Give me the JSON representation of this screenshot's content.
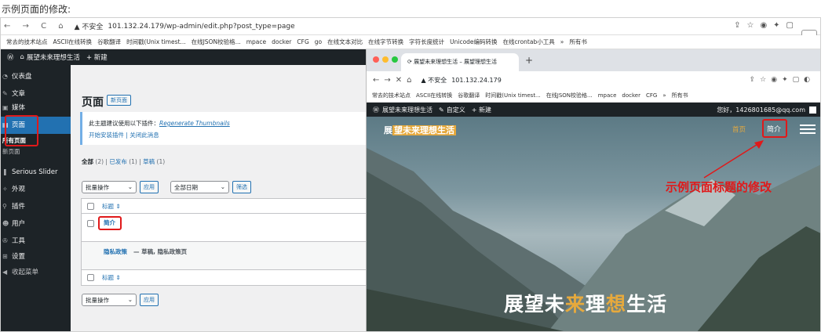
{
  "caption": "示例页面的修改:",
  "back_browser": {
    "nav_icons": "← → C ⌂",
    "warning": "▲ 不安全",
    "url": "101.132.24.179/wp-admin/edit.php?post_type=page",
    "bookmarks": [
      "常去的技术站点",
      "ASCII在线转换",
      "谷歌翻译",
      "时间戳(Unix timest...",
      "在线JSON校验格...",
      "mpace",
      "docker",
      "CFG",
      "go",
      "在线文本对比",
      "在线字节转换",
      "字符长度统计",
      "Unicode编码转换",
      "在线crontab小工具",
      "»",
      "所有书"
    ],
    "admin_bar": {
      "site": "展望未来理想生活",
      "new": "+ 新建"
    }
  },
  "sidebar": {
    "items": [
      "仪表盘",
      "文章",
      "媒体",
      "页面",
      "所有页面",
      "新页面",
      "Serious Slider",
      "外观",
      "插件",
      "用户",
      "工具",
      "设置",
      "收起菜单"
    ]
  },
  "wp_main": {
    "title": "页面",
    "add_new": "新页面",
    "notice_text": "此主题建议使用以下插件：",
    "notice_plugin": "Regenerate Thumbnails",
    "notice_links": "开始安装插件 | 关闭此消息",
    "filter_all": "全部",
    "filter_all_count": "(2)",
    "filter_published": "已发布",
    "filter_published_count": "(1)",
    "filter_draft": "草稿",
    "filter_draft_count": "(1)",
    "bulk_action": "批量操作",
    "apply": "应用",
    "all_dates": "全部日期",
    "filter_btn": "筛选",
    "col_title": "标题 ⇕",
    "row1_title": "简介",
    "row2_title": "隐私政策",
    "row2_meta": "— 草稿, 隐私政策页"
  },
  "front_browser": {
    "tab_title": "展望未来理想生活 – 展望理想生活",
    "warning": "▲ 不安全",
    "url": "101.132.24.179",
    "bookmarks": [
      "常去的技术站点",
      "ASCII在线转换",
      "谷歌翻译",
      "时间戳(Unix timest...",
      "在线JSON校验格...",
      "mpace",
      "docker",
      "CFG",
      "»",
      "所有书"
    ],
    "admin_bar": {
      "site": "展望未来理想生活",
      "customize": "自定义",
      "new": "+ 新建",
      "user": "您好，1426801685@qq.com"
    },
    "logo_pre": "展",
    "logo_hl": "望未来理想生活",
    "menu_home": "首页",
    "menu_intro": "简介",
    "annotation": "示例页面标题的修改",
    "hero_a": "展望未",
    "hero_b": "来",
    "hero_c": "理",
    "hero_d": "想",
    "hero_e": "生活"
  },
  "colors": {
    "accent_red": "#e0191a",
    "wp_blue": "#2271b1",
    "gold": "#e6a93d",
    "admin_dark": "#1d2327"
  }
}
